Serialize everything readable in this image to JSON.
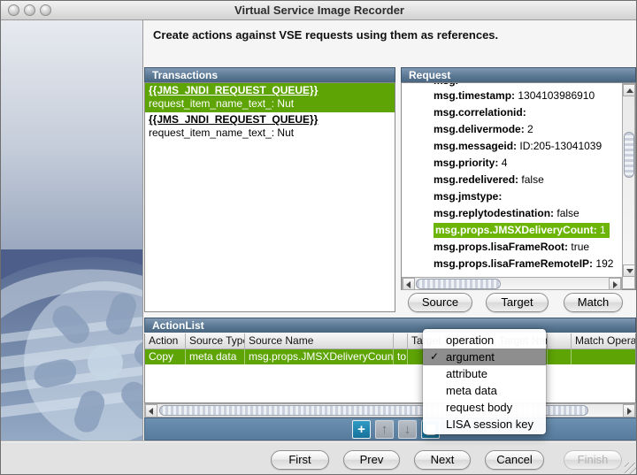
{
  "colors": {
    "selection_green": "#5ea404",
    "highlight_green": "#6cb405",
    "panel_header_blue": "#5b7995",
    "toolbar_blue": "#567b9d"
  },
  "window": {
    "title": "Virtual Service Image Recorder"
  },
  "instruction": "Create actions against VSE requests using them as references.",
  "transactions": {
    "title": "Transactions",
    "items": [
      {
        "queue": "{{JMS_JNDI_REQUEST_QUEUE}}",
        "detail": "request_item_name_text_: Nut"
      },
      {
        "queue": "{{JMS_JNDI_REQUEST_QUEUE}}",
        "detail": "request_item_name_text_: Nut"
      }
    ]
  },
  "request": {
    "title": "Request",
    "clipped_row": "msg.",
    "rows": [
      {
        "key": "msg.timestamp:",
        "value": "1304103986910"
      },
      {
        "key": "msg.correlationid:",
        "value": ""
      },
      {
        "key": "msg.delivermode:",
        "value": "2"
      },
      {
        "key": "msg.messageid:",
        "value": "ID:205-13041039"
      },
      {
        "key": "msg.priority:",
        "value": "4"
      },
      {
        "key": "msg.redelivered:",
        "value": "false"
      },
      {
        "key": "msg.jmstype:",
        "value": ""
      },
      {
        "key": "msg.replytodestination:",
        "value": "false"
      },
      {
        "key": "msg.props.JMSXDeliveryCount:",
        "value": "1"
      },
      {
        "key": "msg.props.lisaFrameRoot:",
        "value": "true"
      },
      {
        "key": "msg.props.lisaFrameRemoteIP:",
        "value": "192"
      }
    ],
    "buttons": {
      "source": "Source",
      "target": "Target",
      "match": "Match"
    }
  },
  "actionlist": {
    "title": "ActionList",
    "columns": {
      "action": "Action",
      "source_type": "Source Type",
      "source_name": "Source Name",
      "connector": "",
      "target_type": "Target Type",
      "target_name": "Target Name",
      "spacer": "",
      "match_operation": "Match Operation"
    },
    "row": {
      "action": "Copy",
      "source_type": "meta data",
      "source_name": "msg.props.JMSXDeliveryCount",
      "connector": "to",
      "target_type": "",
      "target_name": "",
      "spacer": "",
      "match_operation": ""
    }
  },
  "type_menu": {
    "check_glyph": "✓",
    "options": [
      {
        "label": "operation"
      },
      {
        "label": "argument"
      },
      {
        "label": "attribute"
      },
      {
        "label": "meta data"
      },
      {
        "label": "request body"
      },
      {
        "label": "LISA session key"
      }
    ],
    "selected": "argument"
  },
  "list_toolbar": {
    "add": "+",
    "move_up": "↑",
    "move_down": "↓"
  },
  "footer": {
    "first": "First",
    "prev": "Prev",
    "next": "Next",
    "cancel": "Cancel",
    "finish": "Finish"
  }
}
